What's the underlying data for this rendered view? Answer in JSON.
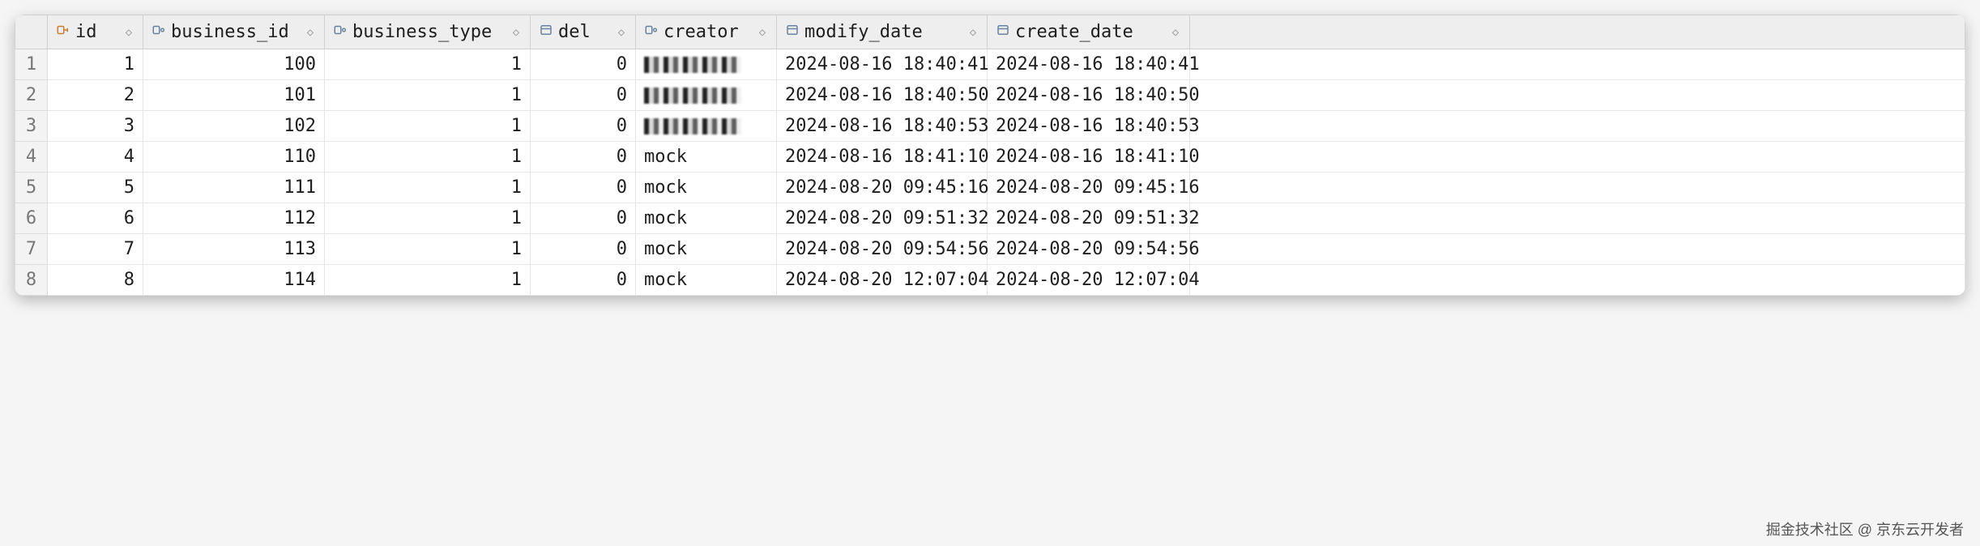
{
  "columns": [
    {
      "key": "id",
      "label": "id",
      "icon": "pk",
      "numeric": true
    },
    {
      "key": "business_id",
      "label": "business_id",
      "icon": "key",
      "numeric": true
    },
    {
      "key": "business_type",
      "label": "business_type",
      "icon": "key",
      "numeric": true
    },
    {
      "key": "del",
      "label": "del",
      "icon": "col",
      "numeric": true
    },
    {
      "key": "creator",
      "label": "creator",
      "icon": "key",
      "numeric": false
    },
    {
      "key": "modify_date",
      "label": "modify_date",
      "icon": "col",
      "numeric": false
    },
    {
      "key": "create_date",
      "label": "create_date",
      "icon": "col",
      "numeric": false
    }
  ],
  "rows": [
    {
      "n": 1,
      "id": 1,
      "business_id": 100,
      "business_type": 1,
      "del": 0,
      "creator": "__REDACTED__",
      "modify_date": "2024-08-16 18:40:41",
      "create_date": "2024-08-16 18:40:41"
    },
    {
      "n": 2,
      "id": 2,
      "business_id": 101,
      "business_type": 1,
      "del": 0,
      "creator": "__REDACTED__",
      "modify_date": "2024-08-16 18:40:50",
      "create_date": "2024-08-16 18:40:50"
    },
    {
      "n": 3,
      "id": 3,
      "business_id": 102,
      "business_type": 1,
      "del": 0,
      "creator": "__REDACTED__",
      "modify_date": "2024-08-16 18:40:53",
      "create_date": "2024-08-16 18:40:53"
    },
    {
      "n": 4,
      "id": 4,
      "business_id": 110,
      "business_type": 1,
      "del": 0,
      "creator": "mock",
      "modify_date": "2024-08-16 18:41:10",
      "create_date": "2024-08-16 18:41:10"
    },
    {
      "n": 5,
      "id": 5,
      "business_id": 111,
      "business_type": 1,
      "del": 0,
      "creator": "mock",
      "modify_date": "2024-08-20 09:45:16",
      "create_date": "2024-08-20 09:45:16"
    },
    {
      "n": 6,
      "id": 6,
      "business_id": 112,
      "business_type": 1,
      "del": 0,
      "creator": "mock",
      "modify_date": "2024-08-20 09:51:32",
      "create_date": "2024-08-20 09:51:32"
    },
    {
      "n": 7,
      "id": 7,
      "business_id": 113,
      "business_type": 1,
      "del": 0,
      "creator": "mock",
      "modify_date": "2024-08-20 09:54:56",
      "create_date": "2024-08-20 09:54:56"
    },
    {
      "n": 8,
      "id": 8,
      "business_id": 114,
      "business_type": 1,
      "del": 0,
      "creator": "mock",
      "modify_date": "2024-08-20 12:07:04",
      "create_date": "2024-08-20 12:07:04"
    }
  ],
  "watermark": "掘金技术社区 @ 京东云开发者"
}
